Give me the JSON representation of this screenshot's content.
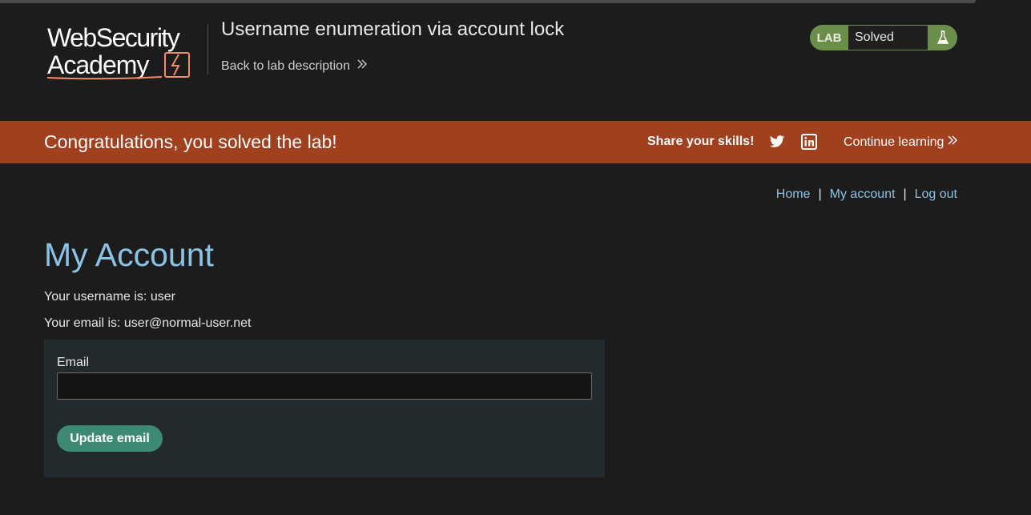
{
  "header": {
    "logo": {
      "line1": "WebSecurity",
      "line2": "Academy",
      "icon": "lightning-logo-icon"
    },
    "lab_title": "Username enumeration via account lock",
    "back_link": "Back to lab description",
    "back_icon": "double-chevron-right-icon",
    "badge": {
      "label": "LAB",
      "status": "Solved",
      "icon": "flask-icon",
      "color": "#6b8f4a"
    }
  },
  "banner": {
    "message": "Congratulations, you solved the lab!",
    "share_label": "Share your skills!",
    "share_icons": [
      "twitter-icon",
      "linkedin-icon"
    ],
    "continue_label": "Continue learning",
    "color": "#a0401f"
  },
  "nav": {
    "home": "Home",
    "my_account": "My account",
    "log_out": "Log out",
    "separator": "|"
  },
  "main": {
    "title": "My Account",
    "username_line": "Your username is: user",
    "email_line": "Your email is: user@normal-user.net",
    "form": {
      "email_label": "Email",
      "email_value": "",
      "submit_label": "Update email"
    }
  },
  "colors": {
    "background": "#1c1c1c",
    "link": "#8ac3e6",
    "button": "#3c8a73",
    "panel": "#222a2d"
  }
}
